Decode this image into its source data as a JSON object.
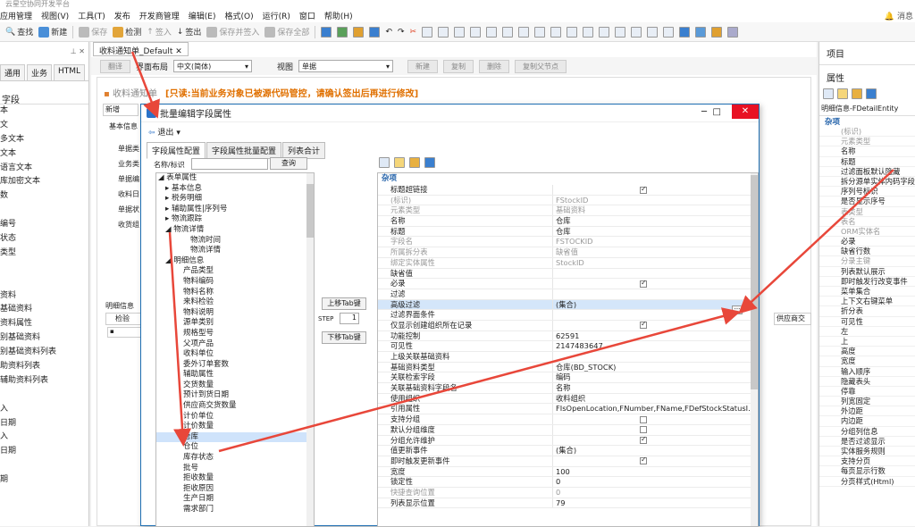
{
  "app_title": "云星空协同开发平台",
  "menu": [
    "应用管理",
    "视图(V)",
    "工具(T)",
    "发布",
    "开发商管理",
    "编辑(E)",
    "格式(O)",
    "运行(R)",
    "窗口",
    "帮助(H)"
  ],
  "menu_right": "消息",
  "toolbar": {
    "find": "查找",
    "new": "新建",
    "save": "保存",
    "check": "检测",
    "checkin": "签入",
    "checkout": "签出",
    "save_checkin": "保存并签入",
    "save_all": "保存全部"
  },
  "left": {
    "tabs": [
      "通用",
      "业务",
      "HTML"
    ],
    "header": "字段",
    "items": [
      "本",
      "文",
      "多文本",
      "文本",
      "语言文本",
      "库加密文本",
      "数",
      "",
      "编号",
      "状态",
      "类型",
      "",
      "",
      "资料",
      "基础资料",
      "资料属性",
      "别基础资料",
      "别基础资料列表",
      "助资料列表",
      "辅助资料列表",
      "",
      "入",
      "日期",
      "入",
      "日期",
      "",
      "期"
    ]
  },
  "doc_tab": "收料通知单_Default",
  "center": {
    "buttons": [
      "翻译",
      "新建",
      "复制",
      "删除",
      "复制父节点"
    ],
    "layout_label": "界面布局",
    "layout_value": "中文(简体)",
    "view_label": "视图",
    "view_value": "单据",
    "header_text": "收料通知单",
    "warning": "[只读:当前业务对象已被源代码管控，请确认签出后再进行修改]",
    "sub_new": "新增",
    "basic_info": "基本信息",
    "left_labels": [
      "单据类",
      "业务类",
      "单据编",
      "收料日",
      "单据状",
      "收货组"
    ],
    "detail_label": "明细信息",
    "detail_col": "检验",
    "right_col": "供应商交"
  },
  "dialog": {
    "title": "批量编辑字段属性",
    "exit": "退出",
    "tabs": [
      "字段属性配置",
      "字段属性批量配置",
      "列表合计"
    ],
    "search_label": "名称/标识",
    "search_btn": "查询",
    "up_btn": "上移Tab键",
    "step_label": "STEP",
    "step_value": "1",
    "down_btn": "下移Tab键",
    "tree": [
      "表单属性",
      "基本信息",
      "税务明细",
      "辅助属性|序列号",
      "物流跟踪",
      "物流详情",
      "物流时间",
      "物流详情",
      "明细信息",
      "产品类型",
      "物料编码",
      "物料名称",
      "来料检验",
      "物料说明",
      "源单类别",
      "规格型号",
      "父项产品",
      "收料单位",
      "委外订单套数",
      "辅助属性",
      "交货数量",
      "预计到货日期",
      "供应商交货数量",
      "计价单位",
      "计价数量",
      "仓库",
      "仓位",
      "库存状态",
      "批号",
      "拒收数量",
      "拒收原因",
      "生产日期",
      "需求部门"
    ],
    "prop_section": "杂项",
    "props": [
      {
        "n": "标题超链接",
        "v": "",
        "chk": true,
        "ro": false
      },
      {
        "n": "(标识)",
        "v": "FStockID",
        "ro": true
      },
      {
        "n": "元素类型",
        "v": "基础资料",
        "ro": true
      },
      {
        "n": "名称",
        "v": "仓库",
        "ro": false
      },
      {
        "n": "标题",
        "v": "仓库",
        "ro": false
      },
      {
        "n": "字段名",
        "v": "FSTOCKID",
        "ro": true
      },
      {
        "n": "所属拆分表",
        "v": "缺省值",
        "ro": true
      },
      {
        "n": "绑定实体属性",
        "v": "StockID",
        "ro": true
      },
      {
        "n": "缺省值",
        "v": "",
        "ro": false
      },
      {
        "n": "必录",
        "v": "",
        "chk": true,
        "ro": false
      },
      {
        "n": "过滤",
        "v": "",
        "ro": false
      },
      {
        "n": "高级过滤",
        "v": "(集合)",
        "ro": false,
        "hl": true
      },
      {
        "n": "过滤界面条件",
        "v": "",
        "ro": false
      },
      {
        "n": "仅显示创建组织所在记录",
        "v": "",
        "chk": true,
        "ro": false
      },
      {
        "n": "功能控制",
        "v": "62591",
        "ro": false
      },
      {
        "n": "可见性",
        "v": "2147483647",
        "ro": false
      },
      {
        "n": "上级关联基础资料",
        "v": "",
        "ro": false
      },
      {
        "n": "基础资料类型",
        "v": "仓库(BD_STOCK)",
        "ro": false
      },
      {
        "n": "关联检索字段",
        "v": "编码",
        "ro": false
      },
      {
        "n": "关联基础资料字段名",
        "v": "名称",
        "ro": false
      },
      {
        "n": "使用组织",
        "v": "收料组织",
        "ro": false
      },
      {
        "n": "引用属性",
        "v": "FIsOpenLocation,FNumber,FName,FDefStockStatusI...",
        "ro": false
      },
      {
        "n": "支持分组",
        "v": "",
        "chk": false,
        "ro": false
      },
      {
        "n": "默认分组维度",
        "v": "",
        "chk": false,
        "ro": false
      },
      {
        "n": "分组允许维护",
        "v": "",
        "chk": true,
        "ro": false
      },
      {
        "n": "值更新事件",
        "v": "(集合)",
        "ro": false
      },
      {
        "n": "即时触发更新事件",
        "v": "",
        "chk": true,
        "ro": false
      },
      {
        "n": "宽度",
        "v": "100",
        "ro": false
      },
      {
        "n": "锁定性",
        "v": "0",
        "ro": false
      },
      {
        "n": "快捷查询位置",
        "v": "0",
        "ro": true
      },
      {
        "n": "列表显示位置",
        "v": "79",
        "ro": false
      }
    ]
  },
  "right": {
    "project": "项目",
    "properties": "属性",
    "entity": "明细信息-FDetailEntity",
    "section": "杂项",
    "rows": [
      [
        "(标识)",
        true
      ],
      [
        "元素类型",
        true
      ],
      [
        "名称",
        false
      ],
      [
        "标题",
        false
      ],
      [
        "过滤面板默认隐藏",
        false
      ],
      [
        "拆分源单实体内码字段",
        false
      ],
      [
        "序列号标识",
        false
      ],
      [
        "是否显示序号",
        false
      ],
      [
        "表类型",
        true
      ],
      [
        "表名",
        true
      ],
      [
        "ORM实体名",
        true
      ],
      [
        "必录",
        false
      ],
      [
        "缺省行数",
        false
      ],
      [
        "分录主键",
        true
      ],
      [
        "列表默认展示",
        false
      ],
      [
        "即时触发行改变事件",
        false
      ],
      [
        "菜单集合",
        false
      ],
      [
        "上下文右键菜单",
        false
      ],
      [
        "折分表",
        false
      ],
      [
        "可见性",
        false
      ],
      [
        "左",
        false
      ],
      [
        "上",
        false
      ],
      [
        "高度",
        false
      ],
      [
        "宽度",
        false
      ],
      [
        "输入顺序",
        false
      ],
      [
        "隐藏表头",
        false
      ],
      [
        "停靠",
        false
      ],
      [
        "列宽固定",
        false
      ],
      [
        "外边距",
        false
      ],
      [
        "内边距",
        false
      ],
      [
        "分组列信息",
        false
      ],
      [
        "是否过滤显示",
        false
      ],
      [
        "实体服务规则",
        false
      ],
      [
        "支持分页",
        false
      ],
      [
        "每页显示行数",
        false
      ],
      [
        "分页样式(Html)",
        false
      ]
    ]
  }
}
